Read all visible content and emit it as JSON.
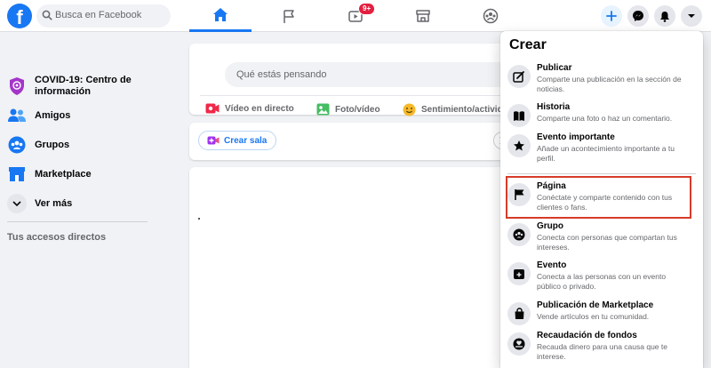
{
  "header": {
    "logo": "f",
    "search_placeholder": "Busca en Facebook",
    "watch_badge": "9+",
    "nav_tabs": [
      "home-icon",
      "flag-icon",
      "video-icon",
      "store-icon",
      "groups-icon"
    ],
    "accent_color": "#1877f2"
  },
  "sidebar": {
    "items": [
      {
        "label": "COVID-19: Centro de información",
        "icon": "shield-icon"
      },
      {
        "label": "Amigos",
        "icon": "friends-icon"
      },
      {
        "label": "Grupos",
        "icon": "groups-icon"
      },
      {
        "label": "Marketplace",
        "icon": "marketplace-icon"
      },
      {
        "label": "Ver más",
        "icon": "chevron-down-icon"
      }
    ],
    "shortcuts_heading": "Tus accesos directos"
  },
  "composer": {
    "placeholder": "Qué estás pensando",
    "actions": [
      "Vídeo en directo",
      "Foto/vídeo",
      "Sentimiento/actividad"
    ]
  },
  "rooms": {
    "create_room": "Crear sala"
  },
  "create_menu": {
    "title": "Crear",
    "items": [
      {
        "title": "Publicar",
        "desc": "Comparte una publicación en la sección de noticias.",
        "icon": "compose-icon"
      },
      {
        "title": "Historia",
        "desc": "Comparte una foto o haz un comentario.",
        "icon": "book-icon"
      },
      {
        "title": "Evento importante",
        "desc": "Añade un acontecimiento importante a tu perfil.",
        "icon": "star-icon"
      },
      {
        "title": "Página",
        "desc": "Conéctate y comparte contenido con tus clientes o fans.",
        "icon": "flag-icon"
      },
      {
        "title": "Grupo",
        "desc": "Conecta con personas que compartan tus intereses.",
        "icon": "group-icon"
      },
      {
        "title": "Evento",
        "desc": "Conecta a las personas con un evento público o privado.",
        "icon": "calendar-icon"
      },
      {
        "title": "Publicación de Marketplace",
        "desc": "Vende artículos en tu comunidad.",
        "icon": "bag-icon"
      },
      {
        "title": "Recaudación de fondos",
        "desc": "Recauda dinero para una causa que te interese.",
        "icon": "fundraiser-icon"
      }
    ]
  }
}
